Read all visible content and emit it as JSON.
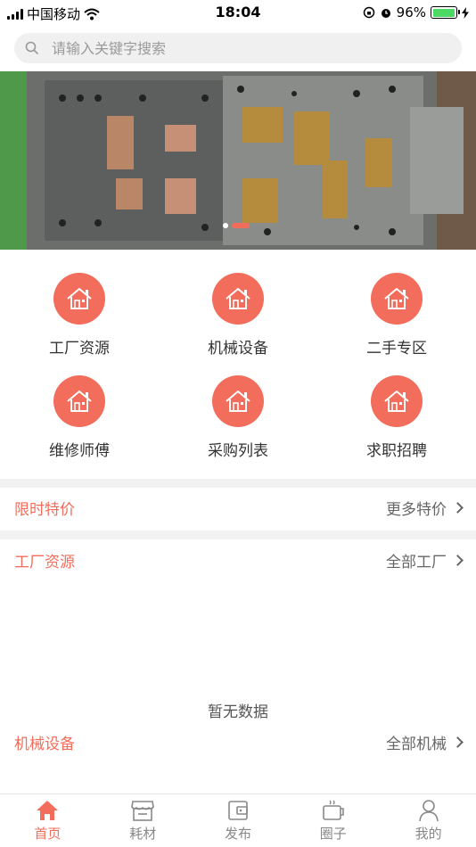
{
  "status_bar": {
    "carrier": "中国移动",
    "time": "18:04",
    "battery": "96%",
    "battery_level": 0.96
  },
  "search": {
    "placeholder": "请输入关键字搜索"
  },
  "banner": {
    "slide_count": 2,
    "active_slide": 2
  },
  "categories": [
    {
      "label": "工厂资源",
      "icon": "house-icon"
    },
    {
      "label": "机械设备",
      "icon": "house-icon"
    },
    {
      "label": "二手专区",
      "icon": "house-icon"
    },
    {
      "label": "维修师傅",
      "icon": "house-icon"
    },
    {
      "label": "采购列表",
      "icon": "house-icon"
    },
    {
      "label": "求职招聘",
      "icon": "house-icon"
    }
  ],
  "sections": {
    "specials": {
      "title": "限时特价",
      "more": "更多特价"
    },
    "factories": {
      "title": "工厂资源",
      "more": "全部工厂",
      "empty": "暂无数据"
    },
    "machines": {
      "title": "机械设备",
      "more": "全部机械"
    }
  },
  "tabs": [
    {
      "label": "首页",
      "icon": "home-icon",
      "active": true
    },
    {
      "label": "耗材",
      "icon": "store-icon",
      "active": false
    },
    {
      "label": "发布",
      "icon": "wallet-icon",
      "active": false
    },
    {
      "label": "圈子",
      "icon": "coffee-cup-icon",
      "active": false
    },
    {
      "label": "我的",
      "icon": "user-icon",
      "active": false
    }
  ],
  "colors": {
    "accent": "#f26d5b",
    "divider": "#f2f2f2",
    "battery": "#4cd964"
  }
}
